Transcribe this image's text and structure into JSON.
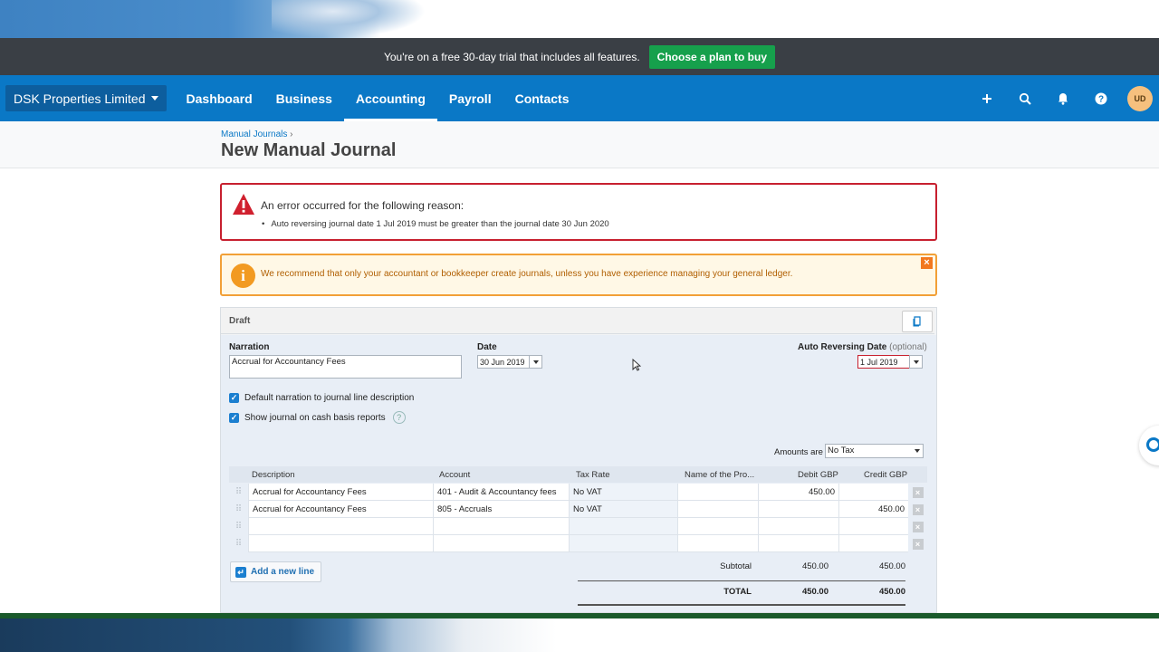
{
  "trial": {
    "message": "You're on a free 30-day trial that includes all features.",
    "cta_label": "Choose a plan to buy"
  },
  "nav": {
    "org_name": "DSK Properties Limited",
    "links": [
      "Dashboard",
      "Business",
      "Accounting",
      "Payroll",
      "Contacts"
    ],
    "active": "Accounting",
    "icons": [
      "plus-icon",
      "search-icon",
      "bell-icon",
      "help-icon"
    ],
    "avatar_initials": "UD"
  },
  "header": {
    "breadcrumb": "Manual Journals",
    "breadcrumb_sep": "›",
    "title": "New Manual Journal"
  },
  "error": {
    "heading": "An error occurred for the following reason:",
    "items": [
      "Auto reversing journal date 1 Jul 2019 must be greater than the journal date 30 Jun 2020"
    ],
    "color": "#c7202f"
  },
  "warning": {
    "message": "We recommend that only your accountant or bookkeeper create journals, unless you have experience managing your general ledger.",
    "icon_glyph": "i",
    "close_glyph": "×",
    "color": "#f2a037"
  },
  "journal": {
    "status": "Draft",
    "narration_label": "Narration",
    "narration_value": "Accrual for Accountancy Fees",
    "date_label": "Date",
    "date_value": "30 Jun 2019",
    "auto_rev_label": "Auto Reversing Date",
    "auto_rev_optional": "(optional)",
    "auto_rev_value": "1 Jul 2019",
    "checkbox_default_narration": "Default narration to journal line description",
    "checkbox_cash_basis": "Show journal on cash basis reports",
    "amounts_are_label": "Amounts are",
    "amounts_are_value": "No Tax",
    "columns": [
      "Description",
      "Account",
      "Tax Rate",
      "Name of the Pro...",
      "Debit GBP",
      "Credit GBP"
    ],
    "lines": [
      {
        "description": "Accrual for Accountancy Fees",
        "account": "401 - Audit & Accountancy fees",
        "tax": "No VAT",
        "name": "",
        "debit": "450.00",
        "credit": ""
      },
      {
        "description": "Accrual for Accountancy Fees",
        "account": "805 - Accruals",
        "tax": "No VAT",
        "name": "",
        "debit": "",
        "credit": "450.00"
      },
      {
        "description": "",
        "account": "",
        "tax": "",
        "name": "",
        "debit": "",
        "credit": ""
      },
      {
        "description": "",
        "account": "",
        "tax": "",
        "name": "",
        "debit": "",
        "credit": ""
      }
    ],
    "add_line_label": "Add a new line",
    "subtotal_label": "Subtotal",
    "subtotal_debit": "450.00",
    "subtotal_credit": "450.00",
    "total_label": "TOTAL",
    "total_debit": "450.00",
    "total_credit": "450.00"
  },
  "colors": {
    "nav_blue": "#0a78c6",
    "trial_green": "#16a04c"
  }
}
